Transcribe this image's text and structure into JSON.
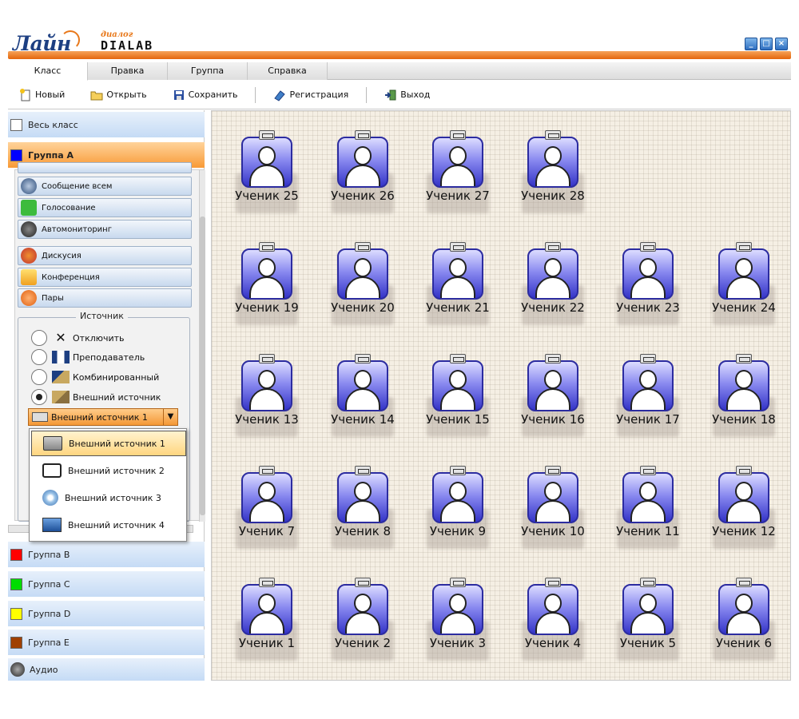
{
  "titlebar": {
    "logo_text": "Лайн",
    "brand_small": "диалог",
    "brand": "DIALAB"
  },
  "tabs": [
    "Класс",
    "Правка",
    "Группа",
    "Справка"
  ],
  "toolbar": {
    "new": "Новый",
    "open": "Открыть",
    "save": "Сохранить",
    "register": "Регистрация",
    "exit": "Выход"
  },
  "sidebar": {
    "whole_class": "Весь класс",
    "group_a": "Группа А",
    "group_b": "Группа B",
    "group_c": "Группа C",
    "group_d": "Группа D",
    "group_e": "Группа E",
    "audio": "Аудио",
    "buttons": {
      "message_all": "Сообщение всем",
      "voting": "Голосование",
      "automonitoring": "Автомониторинг",
      "discussion": "Дискусия",
      "conference": "Конференция",
      "pairs": "Пары"
    },
    "source": {
      "legend": "Источник",
      "off": "Отключить",
      "teacher": "Преподаватель",
      "combined": "Комбинированный",
      "external": "Внешний источник",
      "selected": "Внешний источник 1",
      "options": [
        "Внешний источник 1",
        "Внешний источник 2",
        "Внешний источник 3",
        "Внешний источник 4"
      ]
    }
  },
  "students": [
    "Ученик 25",
    "Ученик 26",
    "Ученик 27",
    "Ученик 28",
    "Ученик 19",
    "Ученик 20",
    "Ученик 21",
    "Ученик 22",
    "Ученик 23",
    "Ученик 24",
    "Ученик 13",
    "Ученик 14",
    "Ученик 15",
    "Ученик 16",
    "Ученик 17",
    "Ученик 18",
    "Ученик 7",
    "Ученик 8",
    "Ученик 9",
    "Ученик 10",
    "Ученик 11",
    "Ученик 12",
    "Ученик 1",
    "Ученик 2",
    "Ученик 3",
    "Ученик 4",
    "Ученик 5",
    "Ученик 6"
  ],
  "colors": {
    "group_a": "#0000ff",
    "group_b": "#ff0000",
    "group_c": "#00dd00",
    "group_d": "#ffff00",
    "group_e": "#a04000",
    "accent": "#f08020"
  }
}
